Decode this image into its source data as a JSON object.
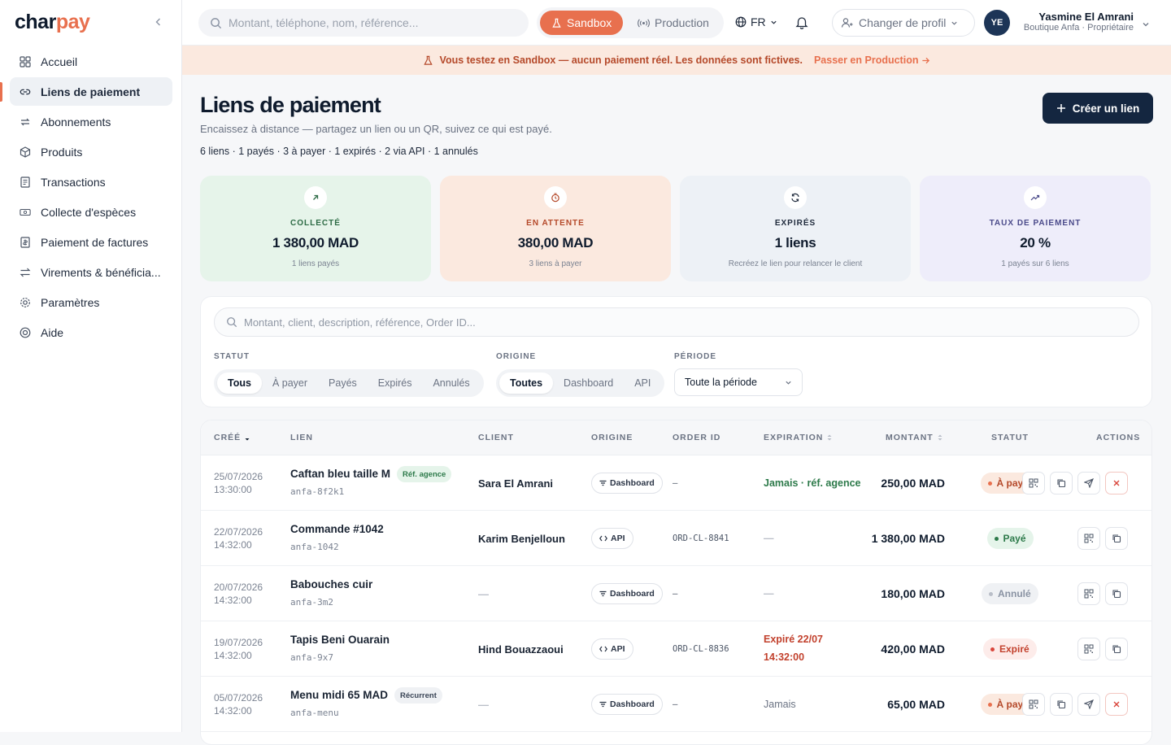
{
  "brand": {
    "logo_main": "char",
    "logo_accent": "pay"
  },
  "sidebar": {
    "items": [
      {
        "label": "Accueil",
        "icon": "grid-icon"
      },
      {
        "label": "Liens de paiement",
        "icon": "link-icon",
        "active": true
      },
      {
        "label": "Abonnements",
        "icon": "repeat-icon"
      },
      {
        "label": "Produits",
        "icon": "box-icon"
      },
      {
        "label": "Transactions",
        "icon": "receipt-icon"
      },
      {
        "label": "Collecte d'espèces",
        "icon": "cash-icon"
      },
      {
        "label": "Paiement de factures",
        "icon": "invoice-icon"
      },
      {
        "label": "Virements & bénéficia...",
        "icon": "transfer-icon"
      },
      {
        "label": "Paramètres",
        "icon": "gear-icon"
      },
      {
        "label": "Aide",
        "icon": "help-icon"
      }
    ]
  },
  "topbar": {
    "search_placeholder": "Montant, téléphone, nom, référence...",
    "env_sandbox": "Sandbox",
    "env_production": "Production",
    "lang": "FR",
    "switch_profile": "Changer de profil",
    "avatar": "YE",
    "user_name": "Yasmine El Amrani",
    "user_role": "Boutique Anfa · Propriétaire"
  },
  "banner": {
    "text": "Vous testez en Sandbox — aucun paiement réel. Les données sont fictives.",
    "link": "Passer en Production"
  },
  "page": {
    "title": "Liens de paiement",
    "subtitle": "Encaissez à distance — partagez un lien ou un QR, suivez ce qui est payé.",
    "summary": "6 liens · 1 payés · 3 à payer · 1 expirés · 2 via API · 1 annulés",
    "create_button": "Créer un lien"
  },
  "stats": [
    {
      "label": "COLLECTÉ",
      "value": "1 380,00 MAD",
      "note": "1 liens payés",
      "bg": "#e6f4ea",
      "fg": "#2d6b45",
      "icon": "arrow-up-right-icon"
    },
    {
      "label": "EN ATTENTE",
      "value": "380,00 MAD",
      "note": "3 liens à payer",
      "bg": "#fbe9df",
      "fg": "#b5492a",
      "icon": "clock-icon"
    },
    {
      "label": "EXPIRÉS",
      "value": "1 liens",
      "note": "Recréez le lien pour relancer le client",
      "bg": "#edf1f6",
      "fg": "#1f2a3c",
      "icon": "refresh-icon"
    },
    {
      "label": "TAUX DE PAIEMENT",
      "value": "20 %",
      "note": "1 payés sur 6 liens",
      "bg": "#eeedfa",
      "fg": "#4a4a8a",
      "icon": "trend-icon"
    }
  ],
  "filters": {
    "search_placeholder": "Montant, client, description, référence, Order ID...",
    "status_label": "STATUT",
    "status_options": [
      "Tous",
      "À payer",
      "Payés",
      "Expirés",
      "Annulés"
    ],
    "origin_label": "ORIGINE",
    "origin_options": [
      "Toutes",
      "Dashboard",
      "API"
    ],
    "period_label": "PÉRIODE",
    "period_value": "Toute la période"
  },
  "table": {
    "headers": {
      "created": "CRÉÉ",
      "link": "LIEN",
      "client": "CLIENT",
      "origin": "ORIGINE",
      "order_id": "ORDER ID",
      "expiration": "EXPIRATION",
      "amount": "MONTANT",
      "status": "STATUT",
      "actions": "ACTIONS"
    },
    "rows": [
      {
        "date": "25/07/2026",
        "time": "13:30:00",
        "name": "Caftan bleu taille M",
        "tag": "Réf. agence",
        "tag_type": "agency",
        "ref": "anfa-8f2k1",
        "client": "Sara El Amrani",
        "origin": "Dashboard",
        "order_id": "—",
        "exp1": "Jamais · réf. agence",
        "exp2": "",
        "exp_color": "#2d7a4a",
        "amount": "250,00 MAD",
        "status": "À payer",
        "status_type": "topay",
        "actions": [
          "qr",
          "copy",
          "send",
          "cancel"
        ]
      },
      {
        "date": "22/07/2026",
        "time": "14:32:00",
        "name": "Commande #1042",
        "tag": "",
        "tag_type": "",
        "ref": "anfa-1042",
        "client": "Karim Benjelloun",
        "origin": "API",
        "order_id": "ORD-CL-8841",
        "exp1": "—",
        "exp2": "",
        "exp_color": "#b9bec8",
        "amount": "1 380,00 MAD",
        "status": "Payé",
        "status_type": "paid",
        "actions": [
          "qr",
          "copy"
        ]
      },
      {
        "date": "20/07/2026",
        "time": "14:32:00",
        "name": "Babouches cuir",
        "tag": "",
        "tag_type": "",
        "ref": "anfa-3m2",
        "client": "—",
        "origin": "Dashboard",
        "order_id": "—",
        "exp1": "—",
        "exp2": "",
        "exp_color": "#b9bec8",
        "amount": "180,00 MAD",
        "status": "Annulé",
        "status_type": "cancelled",
        "actions": [
          "qr",
          "copy"
        ]
      },
      {
        "date": "19/07/2026",
        "time": "14:32:00",
        "name": "Tapis Beni Ouarain",
        "tag": "",
        "tag_type": "",
        "ref": "anfa-9x7",
        "client": "Hind Bouazzaoui",
        "origin": "API",
        "order_id": "ORD-CL-8836",
        "exp1": "Expiré 22/07",
        "exp2": "14:32:00",
        "exp_color": "#c2412d",
        "amount": "420,00 MAD",
        "status": "Expiré",
        "status_type": "expired",
        "actions": [
          "qr",
          "copy"
        ]
      },
      {
        "date": "05/07/2026",
        "time": "14:32:00",
        "name": "Menu midi 65 MAD",
        "tag": "Récurrent",
        "tag_type": "rec",
        "ref": "anfa-menu",
        "client": "—",
        "origin": "Dashboard",
        "order_id": "—",
        "exp1": "Jamais",
        "exp2": "",
        "exp_color": "#6b7383",
        "amount": "65,00 MAD",
        "status": "À payer",
        "status_type": "topay",
        "actions": [
          "qr",
          "copy",
          "send",
          "cancel"
        ]
      }
    ]
  },
  "colors": {
    "accent": "#e8704e",
    "navy": "#142640"
  }
}
